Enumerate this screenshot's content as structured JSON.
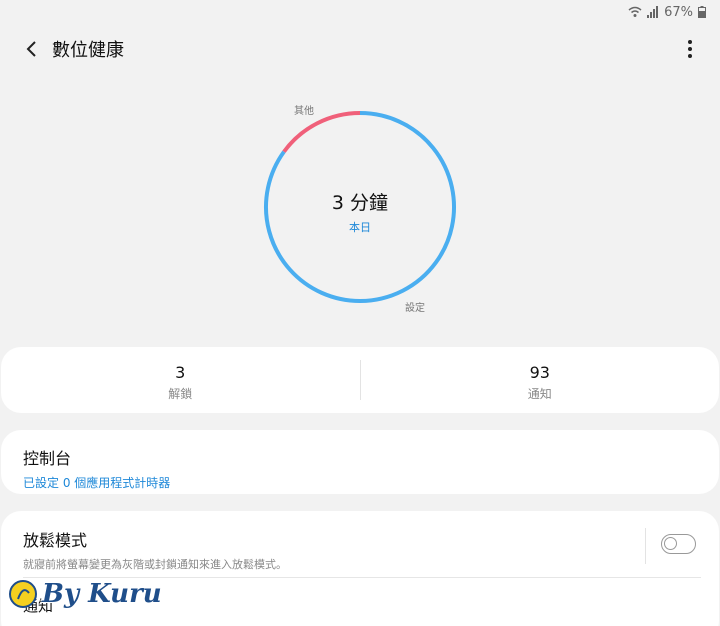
{
  "status_bar": {
    "battery": "67%",
    "icons": [
      "wifi-icon",
      "signal-icon",
      "battery-icon"
    ]
  },
  "header": {
    "title": "數位健康",
    "back_icon": "back-arrow-icon",
    "menu_icon": "more-vert-icon"
  },
  "usage": {
    "total": "3 分鐘",
    "period": "本日",
    "segments": [
      {
        "label": "其他",
        "fraction": 0.15,
        "color": "#f0607a"
      },
      {
        "label": "設定",
        "fraction": 0.85,
        "color": "#4aaef0"
      }
    ]
  },
  "stats": [
    {
      "value": "3",
      "label": "解鎖"
    },
    {
      "value": "93",
      "label": "通知"
    }
  ],
  "dashboard": {
    "title": "控制台",
    "subtitle": "已設定 0 個應用程式計時器"
  },
  "wind_down": {
    "title": "放鬆模式",
    "description": "就寢前將螢幕變更為灰階或封鎖通知來進入放鬆模式。",
    "enabled": false
  },
  "notifications_row": {
    "label": "通知"
  },
  "watermark": {
    "text": "By Kuru"
  }
}
